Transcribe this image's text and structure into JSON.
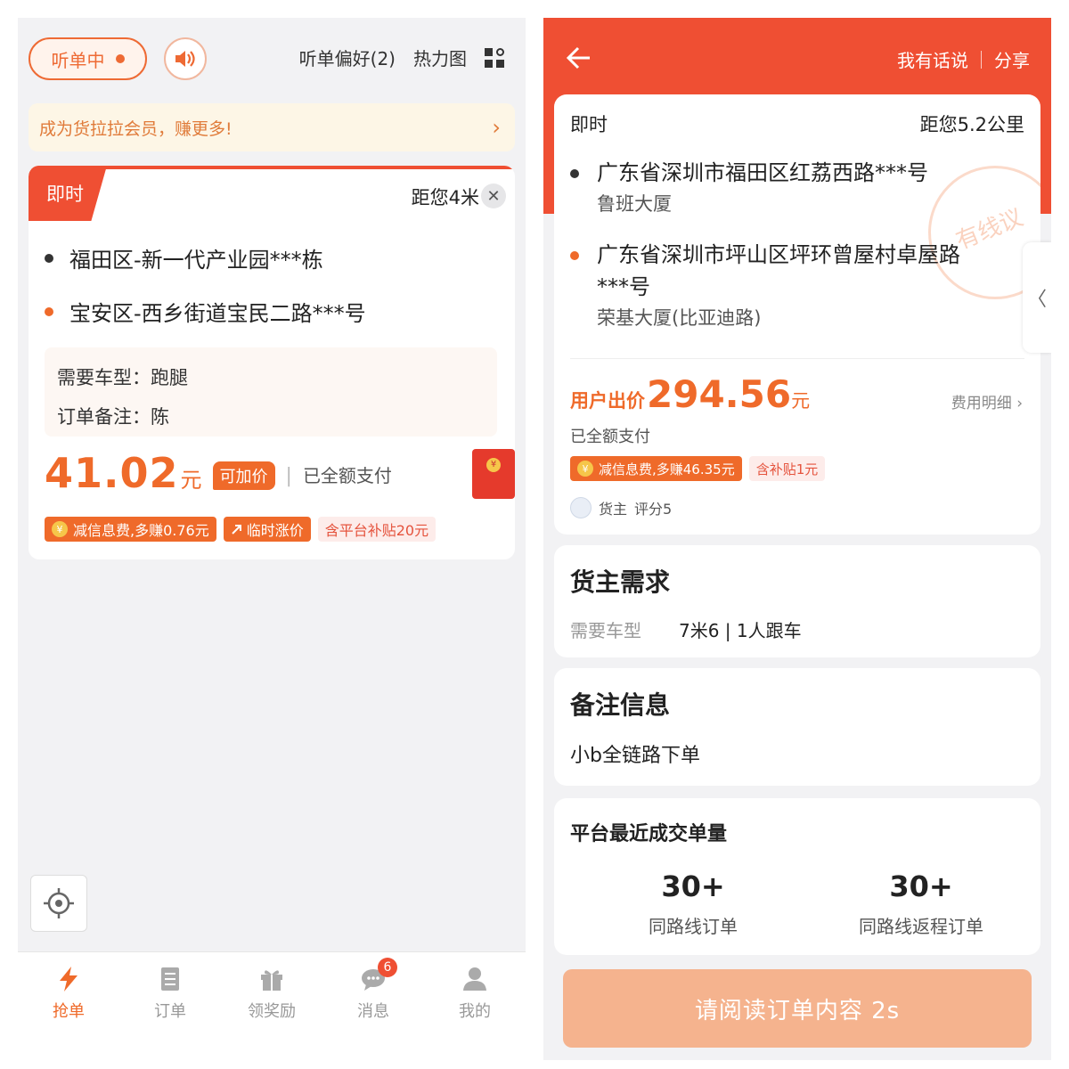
{
  "left": {
    "listen_label": "听单中",
    "links": [
      "听单偏好(2)",
      "热力图"
    ],
    "member_banner": "成为货拉拉会员，赚更多!",
    "order": {
      "tag": "即时",
      "distance": "距您4米",
      "addr_from": "福田区-新一代产业园***栋",
      "addr_to": "宝安区-西乡街道宝民二路***号",
      "vehicle": "需要车型：跑腿",
      "remark": "订单备注：陈",
      "price": "41.02",
      "price_unit": "元",
      "add_price": "可加价",
      "paid": "已全额支付",
      "redpack_coin": "¥",
      "badges": [
        "减信息费,多赚0.76元",
        "临时涨价",
        "含平台补贴20元"
      ],
      "coin_symbol": "¥"
    },
    "tabs": [
      {
        "label": "抢单"
      },
      {
        "label": "订单"
      },
      {
        "label": "领奖励"
      },
      {
        "label": "消息",
        "badge": "6"
      },
      {
        "label": "我的"
      }
    ],
    "colors": {
      "accent": "#ef6a2a",
      "red": "#ef4f33"
    }
  },
  "right": {
    "links": [
      "我有话说",
      "分享"
    ],
    "tag": "即时",
    "distance": "距您5.2公里",
    "addr_from": "广东省深圳市福田区红荔西路***号",
    "addr_from_sub": "鲁班大厦",
    "addr_to_line1": "广东省深圳市坪山区坪环曾屋村卓屋路",
    "addr_to_line2": "***号",
    "addr_to_sub": "荣基大厦(比亚迪路)",
    "stamp_text": "有线议",
    "price_label": "用户出价",
    "price": "294.56",
    "price_unit": "元",
    "fee_detail": "费用明细 ›",
    "paid": "已全额支付",
    "badges": [
      "减信息费,多赚46.35元",
      "含补贴1元"
    ],
    "coin_symbol": "¥",
    "shipper": "货主",
    "shipper_rating": "评分5",
    "side_tab": "〈",
    "req_title": "货主需求",
    "req_key": "需要车型",
    "req_value": "7米6 | 1人跟车",
    "remark_title": "备注信息",
    "remark_value": "小b全链路下单",
    "stats_title": "平台最近成交单量",
    "stats": [
      {
        "n": "30+",
        "d": "同路线订单"
      },
      {
        "n": "30+",
        "d": "同路线返程订单"
      }
    ],
    "read_button": "请阅读订单内容 2s"
  }
}
